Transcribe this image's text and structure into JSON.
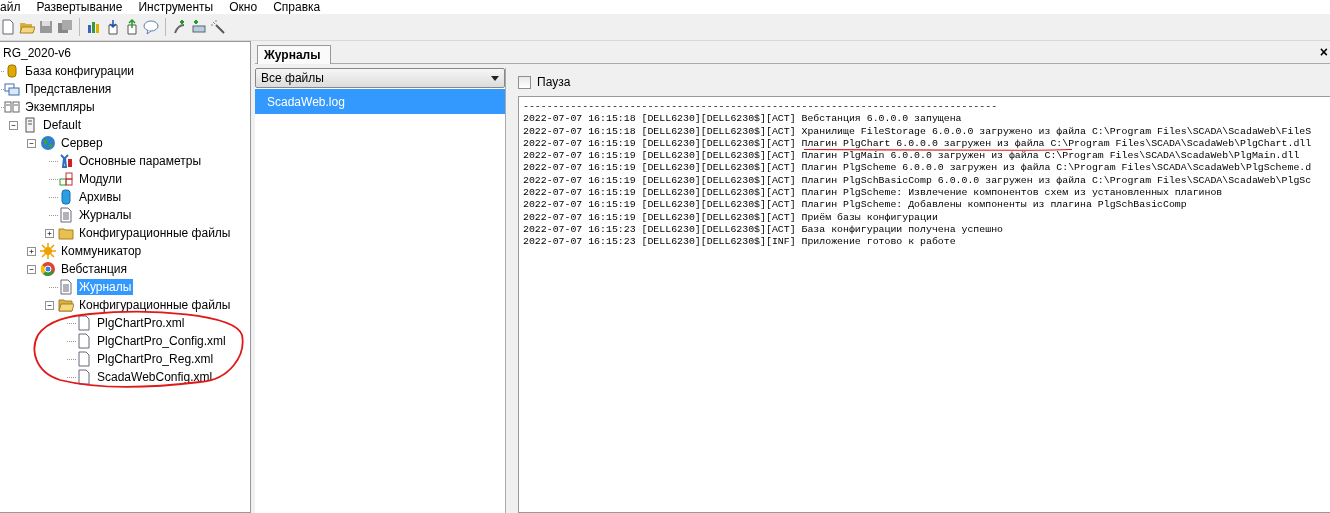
{
  "menu": [
    {
      "label": "айл"
    },
    {
      "label": "Развертывание"
    },
    {
      "label": "Инструменты"
    },
    {
      "label": "Окно"
    },
    {
      "label": "Справка"
    }
  ],
  "tree": {
    "label": "RG_2020-v6",
    "selected": false,
    "children": [
      {
        "label": "База конфигурации",
        "kind": "database",
        "selected": false
      },
      {
        "label": "Представления",
        "kind": "views",
        "selected": false
      },
      {
        "label": "Экземпляры",
        "kind": "instances",
        "selected": false,
        "children": [
          {
            "label": "Default",
            "kind": "server",
            "expanded": true,
            "selected": false,
            "children": [
              {
                "label": "Сервер",
                "kind": "globe",
                "expanded": true,
                "selected": false,
                "children": [
                  {
                    "label": "Основные параметры",
                    "kind": "tools",
                    "selected": false
                  },
                  {
                    "label": "Модули",
                    "kind": "modules",
                    "selected": false
                  },
                  {
                    "label": "Архивы",
                    "kind": "archive",
                    "selected": false
                  },
                  {
                    "label": "Журналы",
                    "kind": "document",
                    "selected": false
                  },
                  {
                    "label": "Конфигурационные файлы",
                    "kind": "folder",
                    "expanded": false,
                    "selected": false
                  }
                ]
              },
              {
                "label": "Коммуникатор",
                "kind": "sun",
                "expanded": false,
                "selected": false
              },
              {
                "label": "Вебстанция",
                "kind": "browser",
                "expanded": true,
                "selected": false,
                "children": [
                  {
                    "label": "Журналы",
                    "kind": "document",
                    "selected": true
                  },
                  {
                    "label": "Конфигурационные файлы",
                    "kind": "folder-open",
                    "expanded": true,
                    "selected": false,
                    "children": [
                      {
                        "label": "PlgChartPro.xml",
                        "kind": "file",
                        "selected": false
                      },
                      {
                        "label": "PlgChartPro_Config.xml",
                        "kind": "file",
                        "selected": false
                      },
                      {
                        "label": "PlgChartPro_Reg.xml",
                        "kind": "file",
                        "selected": false
                      },
                      {
                        "label": "ScadaWebConfig.xml",
                        "kind": "file",
                        "selected": false
                      }
                    ]
                  }
                ]
              }
            ]
          }
        ]
      }
    ]
  },
  "tabs": [
    {
      "label": "Журналы",
      "selected": true
    }
  ],
  "close": "×",
  "file_filter": {
    "value": "Все файлы"
  },
  "files": [
    {
      "label": "ScadaWeb.log",
      "selected": true
    }
  ],
  "pause": {
    "label": "Пауза",
    "checked": false
  },
  "log_lines": [
    "--------------------------------------------------------------------------------",
    "2022-07-07 16:15:18 [DELL6230][DELL6230$][ACT] Вебстанция 6.0.0.0 запущена",
    "2022-07-07 16:15:18 [DELL6230][DELL6230$][ACT] Хранилище FileStorage 6.0.0.0 загружено из файла C:\\Program Files\\SCADA\\ScadaWeb\\FileS",
    "2022-07-07 16:15:19 [DELL6230][DELL6230$][ACT] Плагин PlgChart 6.0.0.0 загружен из файла C:\\Program Files\\SCADA\\ScadaWeb\\PlgChart.dll",
    "2022-07-07 16:15:19 [DELL6230][DELL6230$][ACT] Плагин PlgMain 6.0.0.0 загружен из файла C:\\Program Files\\SCADA\\ScadaWeb\\PlgMain.dll",
    "2022-07-07 16:15:19 [DELL6230][DELL6230$][ACT] Плагин PlgScheme 6.0.0.0 загружен из файла C:\\Program Files\\SCADA\\ScadaWeb\\PlgScheme.d",
    "2022-07-07 16:15:19 [DELL6230][DELL6230$][ACT] Плагин PlgSchBasicComp 6.0.0.0 загружен из файла C:\\Program Files\\SCADA\\ScadaWeb\\PlgSc",
    "2022-07-07 16:15:19 [DELL6230][DELL6230$][ACT] Плагин PlgScheme: Извлечение компонентов схем из установленных плагинов",
    "2022-07-07 16:15:19 [DELL6230][DELL6230$][ACT] Плагин PlgScheme: Добавлены компоненты из плагина PlgSchBasicComp",
    "2022-07-07 16:15:19 [DELL6230][DELL6230$][ACT] Приём базы конфигурации",
    "2022-07-07 16:15:23 [DELL6230][DELL6230$][ACT] База конфигурации получена успешно",
    "2022-07-07 16:15:23 [DELL6230][DELL6230$][INF] Приложение готово к работе"
  ]
}
